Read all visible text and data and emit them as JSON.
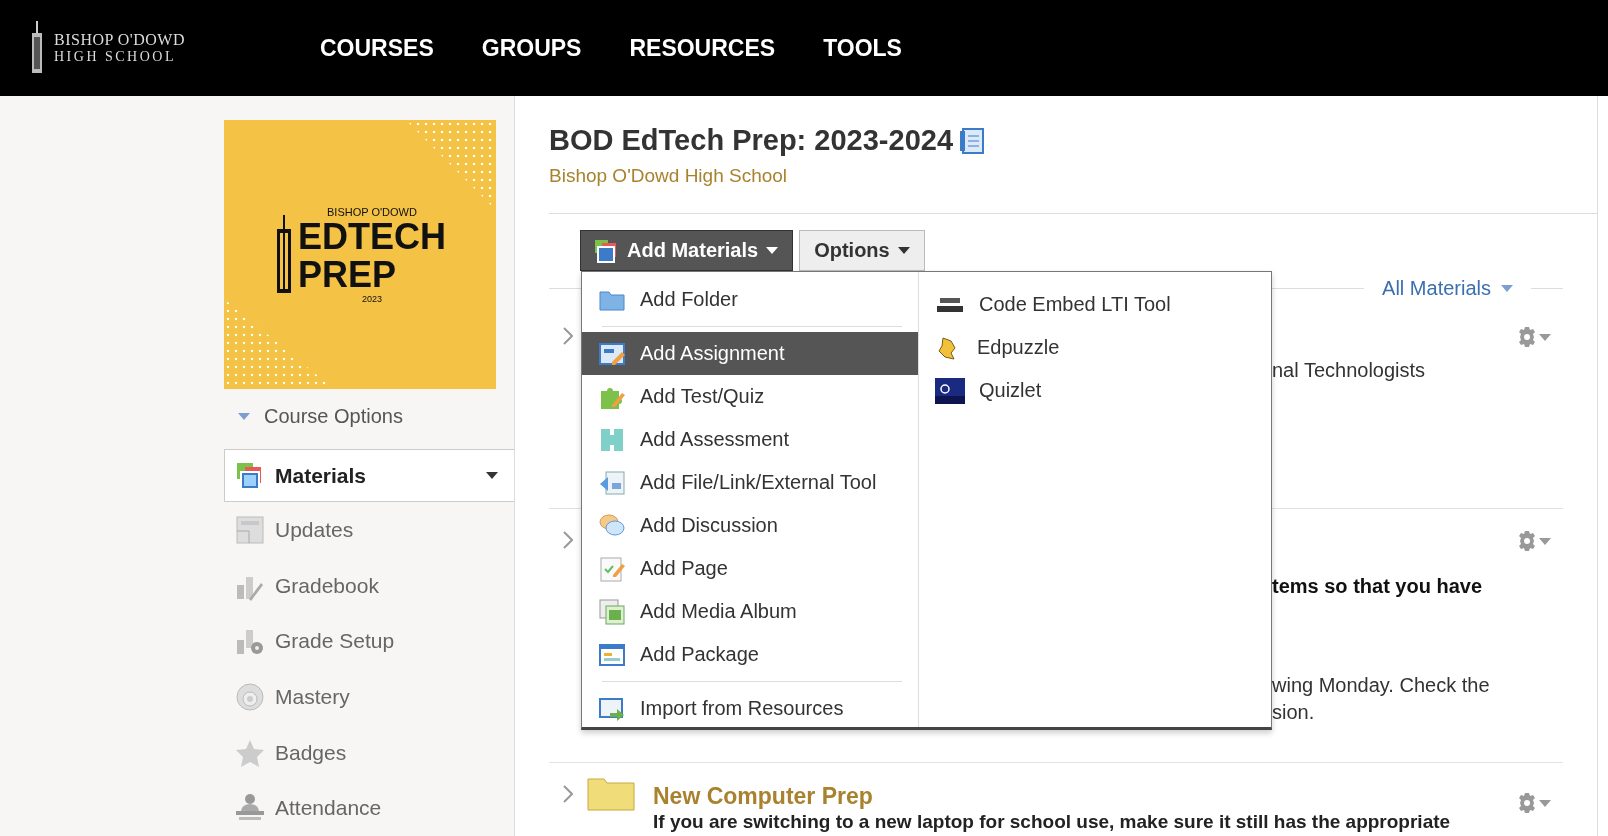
{
  "header": {
    "logo": {
      "line1": "BISHOP O'DOWD",
      "line2": "HIGH SCHOOL"
    },
    "nav": [
      {
        "label": "COURSES"
      },
      {
        "label": "GROUPS"
      },
      {
        "label": "RESOURCES"
      },
      {
        "label": "TOOLS"
      }
    ]
  },
  "sidebar": {
    "course_image": {
      "kicker": "BISHOP O'DOWD",
      "title_1": "EDTECH",
      "title_2": "PREP",
      "year": "2023"
    },
    "course_options": "Course Options",
    "items": [
      {
        "label": "Materials",
        "selected": true
      },
      {
        "label": "Updates",
        "selected": false
      },
      {
        "label": "Gradebook",
        "selected": false
      },
      {
        "label": "Grade Setup",
        "selected": false
      },
      {
        "label": "Mastery",
        "selected": false
      },
      {
        "label": "Badges",
        "selected": false
      },
      {
        "label": "Attendance",
        "selected": false
      }
    ]
  },
  "course": {
    "title": "BOD EdTech Prep: 2023-2024",
    "school": "Bishop O'Dowd High School"
  },
  "toolbar": {
    "add_button": "Add Materials",
    "options_button": "Options"
  },
  "add_menu": {
    "left": [
      {
        "kind": "item",
        "label": "Add Folder",
        "selected": false
      },
      {
        "kind": "divider"
      },
      {
        "kind": "item",
        "label": "Add Assignment",
        "selected": true
      },
      {
        "kind": "item",
        "label": "Add Test/Quiz",
        "selected": false
      },
      {
        "kind": "item",
        "label": "Add Assessment",
        "selected": false
      },
      {
        "kind": "item",
        "label": "Add File/Link/External Tool",
        "selected": false
      },
      {
        "kind": "item",
        "label": "Add Discussion",
        "selected": false
      },
      {
        "kind": "item",
        "label": "Add Page",
        "selected": false
      },
      {
        "kind": "item",
        "label": "Add Media Album",
        "selected": false
      },
      {
        "kind": "item",
        "label": "Add Package",
        "selected": false
      },
      {
        "kind": "divider"
      },
      {
        "kind": "item",
        "label": "Import from Resources",
        "selected": false
      }
    ],
    "right": [
      {
        "label": "Code Embed LTI Tool",
        "selected": false
      },
      {
        "label": "Edpuzzle",
        "selected": false
      },
      {
        "label": "Quizlet",
        "selected": false
      }
    ]
  },
  "filter": {
    "label": "All Materials"
  },
  "materials": [
    {
      "kind": "covered",
      "paragraphs": [
        {
          "bold": false,
          "lines": [
            "nal Technologists"
          ]
        }
      ]
    },
    {
      "kind": "covered",
      "paragraphs": [
        {
          "bold": true,
          "lines": [
            "tems so that you have"
          ]
        },
        {
          "bold": false,
          "lines": [
            "wing Monday. Check the",
            "sion."
          ]
        }
      ]
    },
    {
      "kind": "folder",
      "title": "New Computer Prep",
      "description": "If you are switching to a new laptop for school use, make sure it still has the appropriate"
    }
  ]
}
